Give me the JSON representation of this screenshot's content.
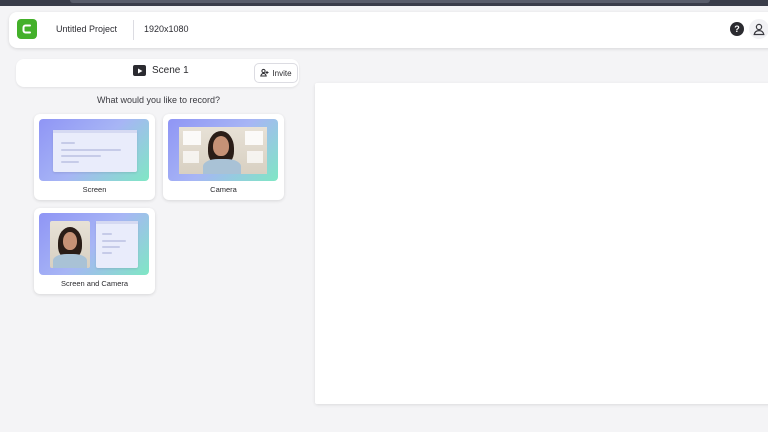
{
  "header": {
    "project_title": "Untitled Project",
    "resolution": "1920x1080",
    "help_label": "?"
  },
  "scene": {
    "label": "Scene 1",
    "invite_label": "Invite"
  },
  "record": {
    "question": "What would you like to record?",
    "options": [
      {
        "label": "Screen"
      },
      {
        "label": "Camera"
      },
      {
        "label": "Screen and Camera"
      }
    ]
  },
  "colors": {
    "brand_green": "#43b02a",
    "thumb_gradient_start": "#8f95f5",
    "thumb_gradient_end": "#7fe7c4"
  },
  "icons": [
    "camtasia-logo-icon",
    "help-icon",
    "user-icon",
    "play-icon",
    "invite-icon"
  ]
}
